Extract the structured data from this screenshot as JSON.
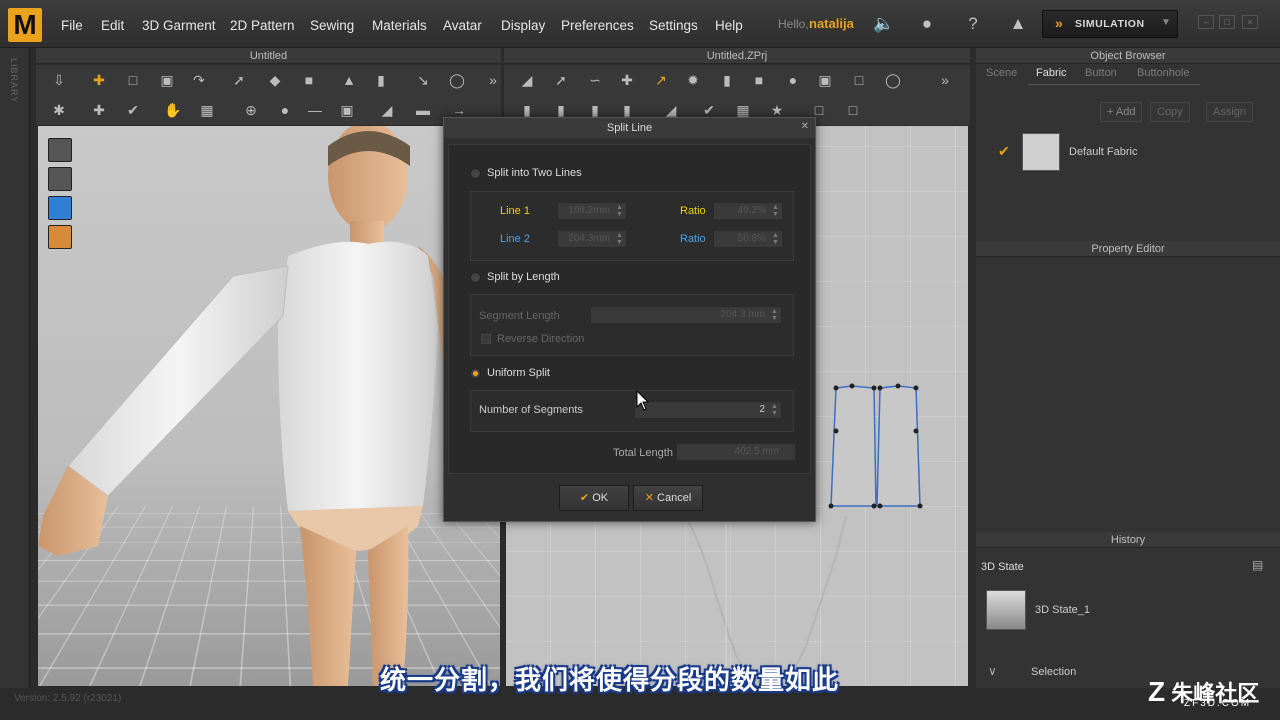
{
  "app": {
    "logo_letter": "M",
    "window_title_3d": "Untitled",
    "window_title_2d": "Untitled.ZPrj",
    "version": "Version: 2.5.92   (r23021)",
    "library_label": "LIBRARY"
  },
  "menu": [
    "File",
    "Edit",
    "3D Garment",
    "2D Pattern",
    "Sewing",
    "Materials",
    "Avatar",
    "Display",
    "Preferences",
    "Settings",
    "Help"
  ],
  "user": {
    "greeting": "Hello,",
    "name": "natalija"
  },
  "topbar_icons": [
    "speaker-icon",
    "user-icon",
    "help-icon",
    "tshirt-icon"
  ],
  "simulation": {
    "label": "SIMULATION"
  },
  "right_panel": {
    "object_browser": {
      "title": "Object Browser",
      "tabs": [
        "Scene",
        "Fabric",
        "Button",
        "Buttonhole"
      ],
      "active_tab": "Fabric",
      "buttons": [
        "+ Add",
        "Copy",
        "Assign"
      ],
      "item": "Default Fabric"
    },
    "property_editor": {
      "title": "Property Editor"
    },
    "history": {
      "title": "History",
      "state_header": "3D State",
      "item": "3D State_1",
      "selection": "Selection"
    }
  },
  "dialog": {
    "title": "Split Line",
    "option_two_lines": "Split into Two Lines",
    "line1_label": "Line 1",
    "line1_value": "198.2mm",
    "line2_label": "Line 2",
    "line2_value": "204.3mm",
    "ratio_label": "Ratio",
    "ratio1_value": "49.2%",
    "ratio2_value": "50.8%",
    "option_by_length": "Split by Length",
    "segment_length_label": "Segment Length",
    "segment_length_value": "204.3 mm",
    "reverse_direction": "Reverse Direction",
    "option_uniform": "Uniform Split",
    "segments_label": "Number of Segments",
    "segments_value": "2",
    "total_length_label": "Total Length",
    "total_length_value": "402.5 mm",
    "ok": "OK",
    "cancel": "Cancel",
    "selected_option": "Uniform Split"
  },
  "subtitle": "统一分割，我们将使得分段的数量如此",
  "watermark": {
    "text": "朱峰社区",
    "url": "ZF3D.COM"
  },
  "colors": {
    "accent": "#e8a21c",
    "line1": "#e8d400",
    "line2": "#4aa3e8",
    "pattern_outline": "#3a6fc4"
  }
}
